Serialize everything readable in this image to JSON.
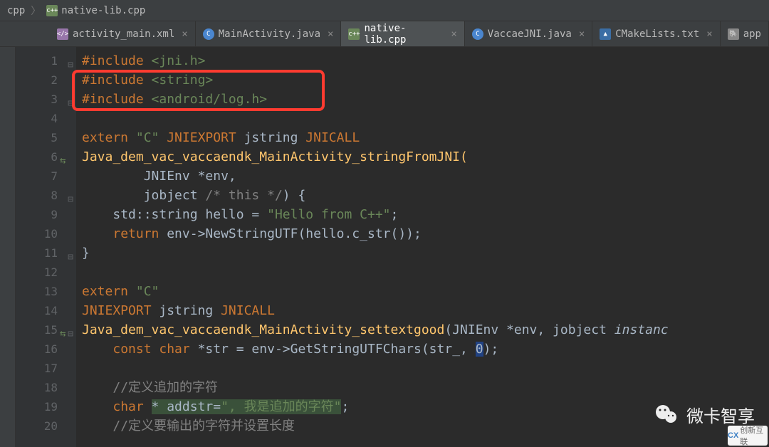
{
  "breadcrumb": {
    "parent": "cpp",
    "file": "native-lib.cpp"
  },
  "tabs": [
    {
      "label": "activity_main.xml",
      "icon": "xml",
      "active": false
    },
    {
      "label": "MainActivity.java",
      "icon": "java",
      "active": false
    },
    {
      "label": "native-lib.cpp",
      "icon": "cpp",
      "active": true
    },
    {
      "label": "VaccaeJNI.java",
      "icon": "java",
      "active": false
    },
    {
      "label": "CMakeLists.txt",
      "icon": "cmake",
      "active": false
    },
    {
      "label": "app",
      "icon": "app",
      "active": false
    }
  ],
  "code": {
    "l1": {
      "pre": "#include ",
      "inc": "<jni.h>"
    },
    "l2": {
      "pre": "#include ",
      "inc": "<string>"
    },
    "l3": {
      "pre": "#include ",
      "inc": "<android/log.h>"
    },
    "l5": {
      "extern": "extern ",
      "c": "\"C\" ",
      "exp": "JNIEXPORT ",
      "jstr": "jstring ",
      "call": "JNICALL"
    },
    "l6": "Java_dem_vac_vaccaendk_MainActivity_stringFromJNI(",
    "l7": {
      "type": "JNIEnv ",
      "ptr": "*env,"
    },
    "l8": {
      "type": "jobject ",
      "cm": "/* this */",
      "br": ") {"
    },
    "l9": {
      "a": "std::string hello = ",
      "s": "\"Hello from C++\"",
      "e": ";"
    },
    "l10": {
      "ret": "return ",
      "body": "env->NewStringUTF(hello.c_str());"
    },
    "l11": "}",
    "l13": {
      "extern": "extern ",
      "c": "\"C\""
    },
    "l14": {
      "exp": "JNIEXPORT ",
      "jstr": "jstring ",
      "call": "JNICALL"
    },
    "l15": {
      "fn": "Java_dem_vac_vaccaendk_MainActivity_settextgood",
      "args": "(JNIEnv *env, jobject ",
      "inst": "instanc"
    },
    "l16": {
      "kw": "const char ",
      "body": "*str = env->GetStringUTFChars(str_, ",
      "zero": "0",
      "end": ");"
    },
    "l18_cm": "//定义追加的字符",
    "l19": {
      "kw": "char ",
      "mid": "* addstr=",
      "str": "\", 我是追加的字符\"",
      "end": ";"
    },
    "l20_cm": "//定义要输出的字符并设置长度"
  },
  "watermark": "微卡智享",
  "corner_badge": "创新互联"
}
